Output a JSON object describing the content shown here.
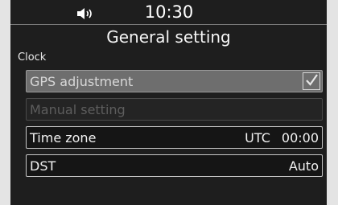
{
  "status": {
    "time": "10:30",
    "speaker_icon": "speaker-icon"
  },
  "title": "General setting",
  "section_label": "Clock",
  "rows": [
    {
      "label": "GPS adjustment",
      "checked": true
    },
    {
      "label": "Manual setting"
    },
    {
      "label": "Time zone",
      "value_prefix": "UTC",
      "value": "00:00"
    },
    {
      "label": "DST",
      "value": "Auto"
    }
  ],
  "colors": {
    "screen_bg": "#1e1e1e",
    "highlight": "#6e6e6e"
  }
}
